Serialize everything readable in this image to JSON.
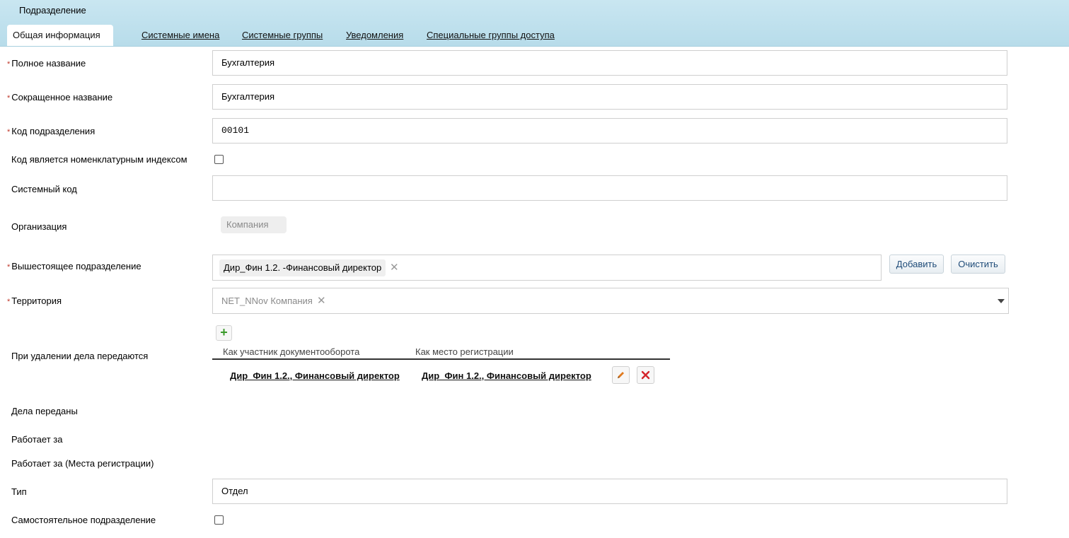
{
  "header": {
    "title": "Подразделение"
  },
  "tabs": [
    {
      "label": "Общая информация"
    },
    {
      "label": "Системные имена"
    },
    {
      "label": "Системные группы"
    },
    {
      "label": "Уведомления"
    },
    {
      "label": "Специальные группы доступа"
    }
  ],
  "form": {
    "required_mark": "*",
    "full_name": {
      "label": "Полное название",
      "value": "Бухгалтерия"
    },
    "short_name": {
      "label": "Сокращенное название",
      "value": "Бухгалтерия"
    },
    "dept_code": {
      "label": "Код подразделения",
      "value": "00101"
    },
    "nomenclature_index": {
      "label": "Код является номенклатурным индексом",
      "checked": false
    },
    "system_code": {
      "label": "Системный код",
      "value": ""
    },
    "organization": {
      "label": "Организация",
      "value": "Компания"
    },
    "parent_dept": {
      "label": "Вышестоящее подразделение",
      "tag": "Дир_Фин 1.2. -Финансовый директор",
      "add_label": "Добавить",
      "clear_label": "Очистить"
    },
    "territory": {
      "label": "Территория",
      "value": "NET_NNov Компания"
    },
    "transfer": {
      "label": "При удалении дела передаются",
      "col1": "Как участник документооборота",
      "col2": "Как место регистрации",
      "rows": [
        {
          "participant": "Дир_Фин 1.2., Финансовый директор",
          "registration": "Дир_Фин 1.2., Финансовый директор"
        }
      ]
    },
    "cases_transferred": {
      "label": "Дела переданы"
    },
    "works_for": {
      "label": "Работает за"
    },
    "works_for_reg": {
      "label": "Работает за (Места регистрации)"
    },
    "type": {
      "label": "Тип",
      "value": "Отдел"
    },
    "independent": {
      "label": "Самостоятельное подразделение",
      "checked": false
    }
  },
  "icons": {
    "close": "close-icon",
    "caret": "chevron-down-icon",
    "add": "plus-icon",
    "edit": "pencil-icon",
    "delete": "delete-x-icon"
  }
}
